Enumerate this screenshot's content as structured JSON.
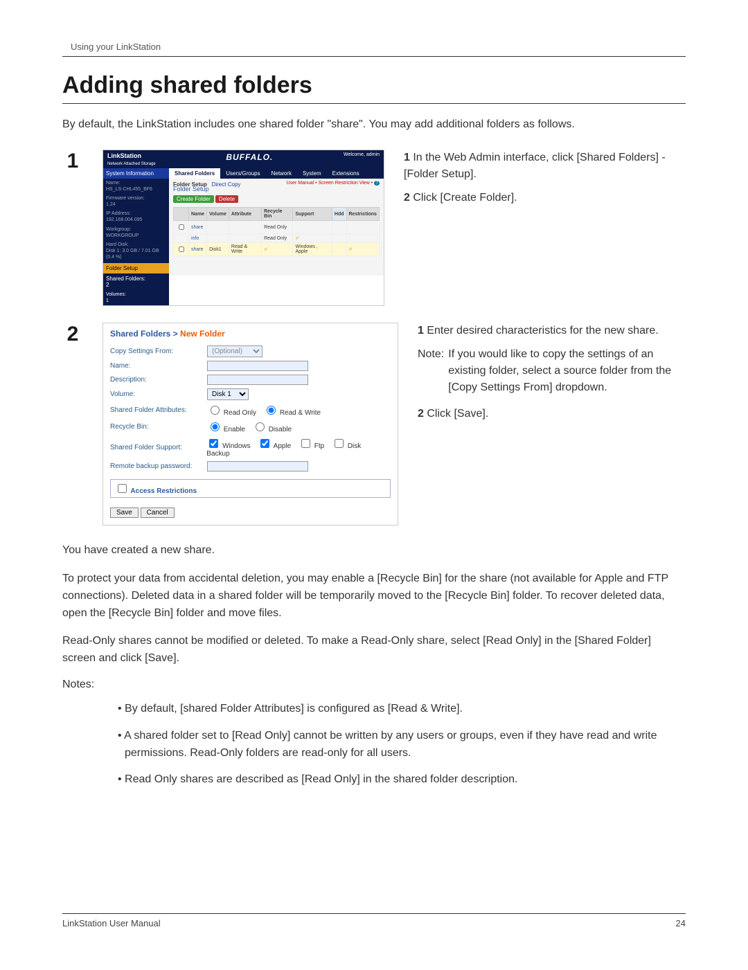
{
  "header": {
    "breadcrumb": "Using your LinkStation"
  },
  "title": "Adding shared folders",
  "intro": "By default, the LinkStation includes one shared folder \"share\".  You may add additional folders as follows.",
  "step1": {
    "num": "1",
    "line1_a": "1",
    "line1_b": " In the Web Admin interface, click [Shared Folders] - [Folder Setup].",
    "line2_a": "2",
    "line2_b": " Click [Create Folder].",
    "ui": {
      "brand_left": "LinkStation",
      "brand_sub": "Network Attached Storage",
      "brand_center": "BUFFALO.",
      "brand_right": "Welcome, admin",
      "sidebar": {
        "sysinfo": "System Information",
        "name_lbl": "Name:",
        "name_val": "HS_LS-CHL455_BF6",
        "fw_lbl": "Firmware version:",
        "fw_val": "1.24",
        "ip_lbl": "IP Address:",
        "ip_val": "192.168.004.095",
        "wg_lbl": "Workgroup:",
        "wg_val": "WORKGROUP",
        "hdd_lbl": "Hard Disk:",
        "hdd_val": "Disk 1: 3.0 GB / 7.01 GB (0.4 %)",
        "folder_setup": "Folder Setup",
        "shared_folders": "Shared Folders:",
        "shared_folders_val": "2",
        "volumes": "Volumes:",
        "volumes_val": "1"
      },
      "tabs": [
        "Shared Folders",
        "Users/Groups",
        "Network",
        "System",
        "Extensions"
      ],
      "crumb_a": "Folder Setup",
      "crumb_b": "Direct Copy",
      "right_link": "User Manual • Screen Restriction View • ",
      "folder_setup_h": "Folder Setup",
      "create_btn": "Create Folder",
      "delete_btn": "Delete",
      "table": {
        "headers": [
          "",
          "Name",
          "Volume",
          "Attribute",
          "Recycle Bin",
          "Support",
          "",
          "Restrictions"
        ],
        "hdd_head": "Hdd",
        "rows": [
          {
            "name": "share",
            "vol": "",
            "attr": "",
            "rb": "Read Only",
            "sup": "",
            "res": ""
          },
          {
            "name": "info",
            "vol": "",
            "attr": "",
            "rb": "Read Only",
            "sup": "✓",
            "res": ""
          },
          {
            "name": "share",
            "vol": "Disk1",
            "attr": "Read & Write",
            "rb": "",
            "sup": "✓",
            "sup2": "Windows , Apple",
            "res": "✓"
          }
        ]
      }
    }
  },
  "step2": {
    "num": "2",
    "line1_a": "1",
    "line1_b": " Enter desired characteristics for the new share.",
    "note_label": "Note:",
    "note_body": "If you would like to copy the settings of an existing folder, select a source folder from the [Copy Settings From] dropdown.",
    "line2_a": "2",
    "line2_b": " Click [Save].",
    "ui": {
      "bc_a": "Shared Folders",
      "bc_sep": " > ",
      "bc_b": "New Folder",
      "rows": {
        "copy_lbl": "Copy Settings From:",
        "copy_val": "(Optional)",
        "name_lbl": "Name:",
        "desc_lbl": "Description:",
        "vol_lbl": "Volume:",
        "vol_val": "Disk 1",
        "sfa_lbl": "Shared Folder Attributes:",
        "sfa_ro": "Read Only",
        "sfa_rw": "Read & Write",
        "rb_lbl": "Recycle Bin:",
        "rb_en": "Enable",
        "rb_dis": "Disable",
        "sfs_lbl": "Shared Folder Support:",
        "sfs_win": "Windows",
        "sfs_app": "Apple",
        "sfs_ftp": "Ftp",
        "sfs_db": "Disk Backup",
        "rbp_lbl": "Remote backup password:",
        "ar_lbl": "Access Restrictions"
      },
      "save": "Save",
      "cancel": "Cancel"
    }
  },
  "created": "You have created a new share.",
  "protect": "To protect your data from accidental deletion, you may enable a [Recycle Bin] for the share (not available for Apple and FTP connections).  Deleted data in a shared folder will be temporarily moved to the [Recycle Bin] folder. To recover deleted data, open the [Recycle Bin] folder and move files.",
  "readonly": "Read-Only shares cannot be modified or deleted.  To make a Read-Only share, select [Read Only] in the [Shared Folder] screen and click [Save].",
  "notes_head": "Notes:",
  "notes": {
    "n1": "• By default, [shared Folder Attributes] is configured as [Read & Write].",
    "n2": "• A shared folder set to [Read Only] cannot be written by any users or groups, even if they have read and write permissions.  Read-Only folders are read-only for all users.",
    "n3": "• Read Only shares are described as [Read Only] in the shared folder description."
  },
  "footer": {
    "left": "LinkStation User Manual",
    "right": "24"
  }
}
